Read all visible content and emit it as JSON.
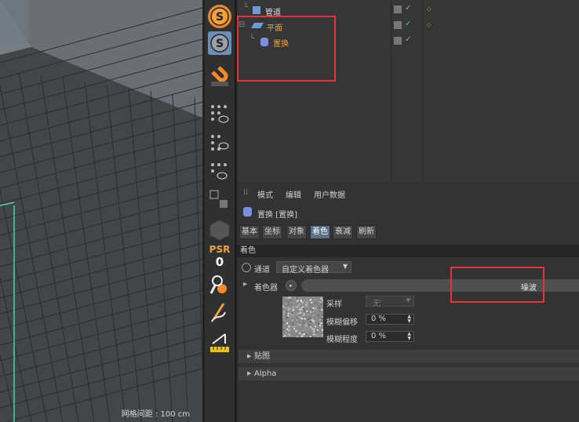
{
  "viewport": {
    "grid_spacing": "网格间距 : 100 cm"
  },
  "toolbar": {
    "psr_label": "PSR",
    "psr_value": "0"
  },
  "object_manager": {
    "rows": [
      {
        "name": "管道"
      },
      {
        "name": "平面"
      },
      {
        "name": "置换"
      }
    ]
  },
  "attribute_manager": {
    "menu": [
      "模式",
      "编辑",
      "用户数据"
    ],
    "object_title": "置换 [置换]",
    "tabs": [
      "基本",
      "坐标",
      "对象",
      "着色",
      "衰减",
      "刷新"
    ],
    "active_tab": "着色",
    "section_title": "着色",
    "channel_label": "通道",
    "channel_value": "自定义着色器",
    "shader_label": "着色器",
    "shader_value": "噪波",
    "sampling_label": "采样",
    "sampling_value": "无",
    "blur_offset_label": "模糊偏移",
    "blur_offset_value": "0 %",
    "blur_scale_label": "模糊程度",
    "blur_scale_value": "0 %",
    "folds": [
      "贴图",
      "Alpha"
    ]
  },
  "colors": {
    "highlight": "#e8323a",
    "accent_orange": "#e8a23a",
    "active_tab": "#5a6f8c"
  }
}
